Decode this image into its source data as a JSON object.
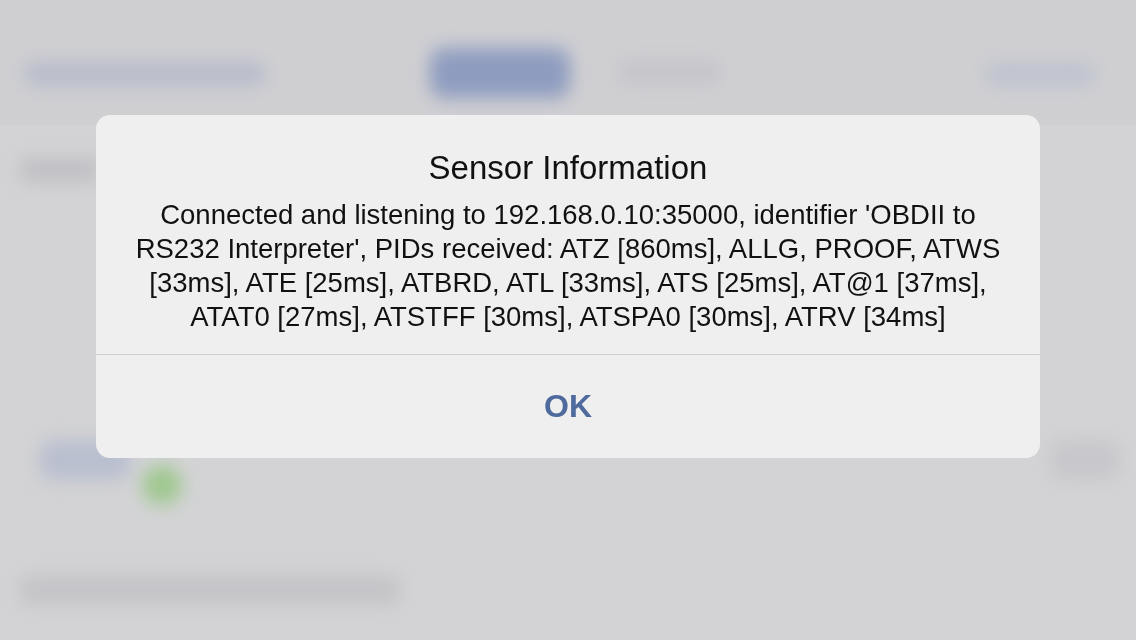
{
  "alert": {
    "title": "Sensor Information",
    "message": "Connected and listening to 192.168.0.10:35000, identifier 'OBDII to RS232 Interpreter', PIDs received: ATZ [860ms], ALLG, PROOF, ATWS [33ms], ATE [25ms], ATBRD, ATL [33ms], ATS [25ms], AT@1 [37ms], ATAT0 [27ms], ATSTFF [30ms], ATSPA0 [30ms], ATRV [34ms]",
    "buttons": [
      "OK"
    ]
  }
}
